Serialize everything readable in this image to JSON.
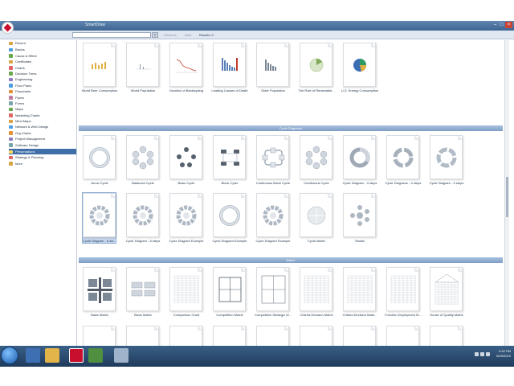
{
  "window": {
    "title": "SmartDraw"
  },
  "toolbar": {
    "search_placeholder": "",
    "search_btn": "Go",
    "back": "Previous",
    "next": "Next",
    "count": "Results: 0"
  },
  "sidebar": {
    "items": [
      {
        "label": "Recent",
        "color": "#d9a441"
      },
      {
        "label": "Basics",
        "color": "#4b9de0"
      },
      {
        "label": "Cause & Effect",
        "color": "#6aa84f"
      },
      {
        "label": "Certificates",
        "color": "#d9a441"
      },
      {
        "label": "Charts",
        "color": "#e06666"
      },
      {
        "label": "Decision Trees",
        "color": "#6aa84f"
      },
      {
        "label": "Engineering",
        "color": "#8e7cc3"
      },
      {
        "label": "Floor Plans",
        "color": "#4b9de0"
      },
      {
        "label": "Flowcharts",
        "color": "#e69138"
      },
      {
        "label": "Flyers",
        "color": "#c27ba0"
      },
      {
        "label": "Forms",
        "color": "#76a5af"
      },
      {
        "label": "Maps",
        "color": "#6aa84f"
      },
      {
        "label": "Marketing Charts",
        "color": "#e06666"
      },
      {
        "label": "Mind Maps",
        "color": "#d9a441"
      },
      {
        "label": "Network & Web Design",
        "color": "#4b9de0"
      },
      {
        "label": "Org Charts",
        "color": "#e69138"
      },
      {
        "label": "Project Management",
        "color": "#8e7cc3"
      },
      {
        "label": "Software Design",
        "color": "#76a5af"
      },
      {
        "label": "Presentations",
        "color": "#ffd966",
        "active": true
      },
      {
        "label": "Strategy & Planning",
        "color": "#e06666"
      },
      {
        "label": "More",
        "color": "#d9a441"
      }
    ]
  },
  "sections": {
    "top": {
      "tiles": [
        {
          "label": "World Beer Consumption",
          "kind": "bars-yellow"
        },
        {
          "label": "World Population",
          "kind": "sparse"
        },
        {
          "label": "Duration of Bankrupting",
          "kind": "line"
        },
        {
          "label": "Leading Causes of Death",
          "kind": "bars-blue"
        },
        {
          "label": "Older Population",
          "kind": "bars-gray"
        },
        {
          "label": "The Role of Renewable...",
          "kind": "pie-green"
        },
        {
          "label": "U.S. Energy Consumption",
          "kind": "pie-blue"
        }
      ]
    },
    "cycle": {
      "title": "Cycle Diagrams",
      "row1": [
        {
          "label": "Arrow Cycle",
          "kind": "ring"
        },
        {
          "label": "Balanced Cycle",
          "kind": "hex"
        },
        {
          "label": "Basic Cycle",
          "kind": "dots"
        },
        {
          "label": "Block Cycle",
          "kind": "blocks"
        },
        {
          "label": "Continuous Block Cycle",
          "kind": "blocks2"
        },
        {
          "label": "Continuous Cycle",
          "kind": "hex"
        },
        {
          "label": "Cycle Diagram - 3 steps",
          "kind": "ring3"
        },
        {
          "label": "Cycle Diagrams - 4 steps",
          "kind": "ring4"
        },
        {
          "label": "Cycle Diagram - 5 steps",
          "kind": "ring5"
        }
      ],
      "row2": [
        {
          "label": "Cycle Diagram - 6 ste...",
          "kind": "gear",
          "selected": true
        },
        {
          "label": "Cycle Diagram - 8 steps",
          "kind": "gear"
        },
        {
          "label": "Cycle Diagram Example",
          "kind": "gear"
        },
        {
          "label": "Cycle Diagram Example",
          "kind": "ring"
        },
        {
          "label": "Cycle Diagram Example",
          "kind": "gear"
        },
        {
          "label": "Cycle Matrix",
          "kind": "circle"
        },
        {
          "label": "Radial",
          "kind": "radial"
        }
      ]
    },
    "matrix": {
      "title": "Matrix",
      "row1": [
        {
          "label": "Basic Matrix",
          "kind": "cross"
        },
        {
          "label": "Block Matrix",
          "kind": "blocks-m"
        },
        {
          "label": "Comparison Chart",
          "kind": "table"
        },
        {
          "label": "Competition Matrix",
          "kind": "quad"
        },
        {
          "label": "Competitive Strategic M...",
          "kind": "quad2"
        },
        {
          "label": "Criteria Decision Matrix",
          "kind": "table"
        },
        {
          "label": "Criteria Decision Matri...",
          "kind": "table"
        },
        {
          "label": "Function Deployment M...",
          "kind": "table"
        },
        {
          "label": "House of Quality Matrix",
          "kind": "house"
        }
      ]
    }
  },
  "taskbar": {
    "time": "4:32 PM",
    "date": "6/29/2010"
  }
}
